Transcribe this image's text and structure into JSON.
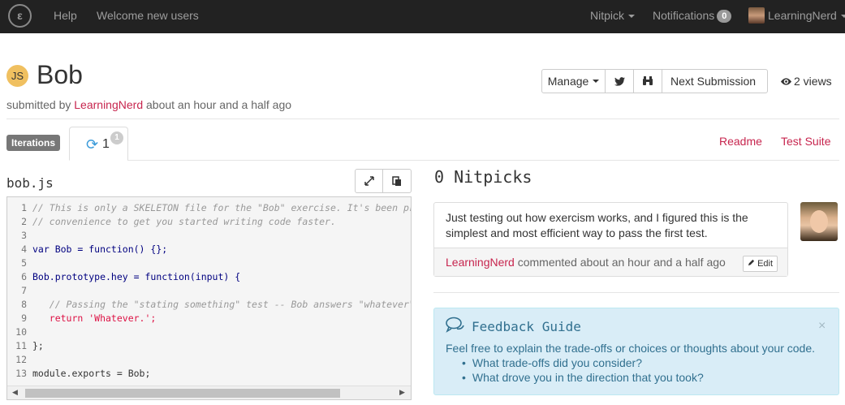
{
  "nav": {
    "logo": "ε",
    "help": "Help",
    "welcome": "Welcome new users",
    "nitpick": "Nitpick",
    "notifications": "Notifications",
    "notifications_count": "0",
    "user": "LearningNerd"
  },
  "header": {
    "badge": "JS",
    "title": "Bob",
    "submitted_by_prefix": "submitted by ",
    "author": "LearningNerd",
    "submitted_time": " about an hour and a half ago"
  },
  "actions": {
    "manage": "Manage",
    "next_submission": "Next Submission",
    "views": "2 views"
  },
  "tabs": {
    "iterations_label": "Iterations",
    "active_number": "1",
    "active_badge": "1",
    "readme": "Readme",
    "test_suite": "Test Suite"
  },
  "file": {
    "name": "bob.js",
    "lines": [
      {
        "n": "1",
        "text": "// This is only a SKELETON file for the \"Bob\" exercise. It's been provided as a"
      },
      {
        "n": "2",
        "text": "// convenience to get you started writing code faster."
      },
      {
        "n": "3",
        "text": ""
      },
      {
        "n": "4",
        "text": "var Bob = function() {};"
      },
      {
        "n": "5",
        "text": ""
      },
      {
        "n": "6",
        "text": "Bob.prototype.hey = function(input) {"
      },
      {
        "n": "7",
        "text": ""
      },
      {
        "n": "8",
        "text": "   // Passing the \"stating something\" test -- Bob answers \"whatever\" to everything"
      },
      {
        "n": "9",
        "text": "   return 'Whatever.';"
      },
      {
        "n": "10",
        "text": ""
      },
      {
        "n": "11",
        "text": "};"
      },
      {
        "n": "12",
        "text": ""
      },
      {
        "n": "13",
        "text": "module.exports = Bob;"
      }
    ]
  },
  "nitpicks": {
    "title": "0 Nitpicks",
    "comment_text": "Just testing out how exercism works, and I figured this is the simplest and most efficient way to pass the first test.",
    "comment_author": "LearningNerd",
    "comment_meta": " commented about an hour and a half ago",
    "edit_label": "Edit"
  },
  "guide": {
    "title": "Feedback Guide",
    "text": "Feel free to explain the trade-offs or choices or thoughts about your code.",
    "items": [
      "What trade-offs did you consider?",
      "What drove you in the direction that you took?"
    ],
    "close": "×"
  }
}
